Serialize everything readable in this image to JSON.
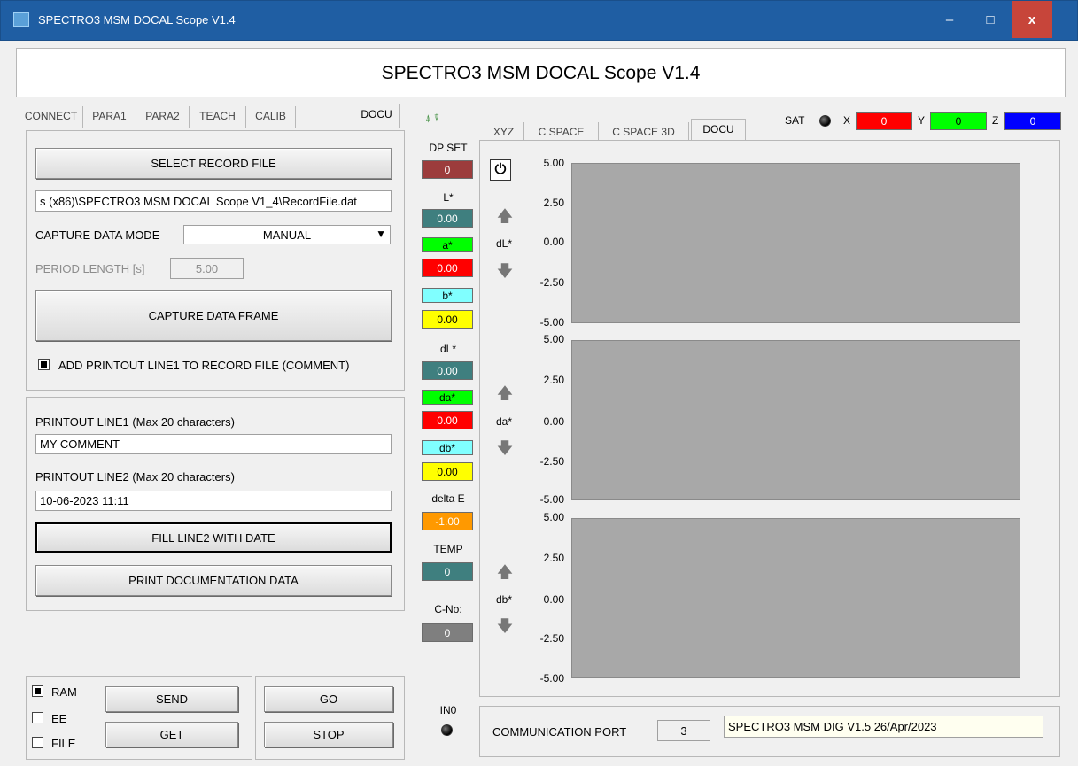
{
  "window": {
    "title": "SPECTRO3 MSM DOCAL Scope V1.4",
    "min_label": "‒",
    "max_label": "□",
    "close_label": "x"
  },
  "header": {
    "title": "SPECTRO3 MSM DOCAL Scope V1.4"
  },
  "left_tabs": [
    {
      "label": "CONNECT"
    },
    {
      "label": "PARA1"
    },
    {
      "label": "PARA2"
    },
    {
      "label": "TEACH"
    },
    {
      "label": "CALIB"
    },
    {
      "label": "DOCU"
    }
  ],
  "docu": {
    "select_record_file": "SELECT RECORD FILE",
    "record_file_path": "s (x86)\\SPECTRO3 MSM DOCAL Scope V1_4\\RecordFile.dat",
    "capture_mode_label": "CAPTURE DATA MODE",
    "capture_mode_value": "MANUAL",
    "period_label": "PERIOD LENGTH [s]",
    "period_value": "5.00",
    "capture_frame": "CAPTURE DATA FRAME",
    "add_printout_label": "ADD PRINTOUT LINE1 TO RECORD FILE (COMMENT)",
    "line1_label": "PRINTOUT LINE1 (Max 20 characters)",
    "line1_value": "MY COMMENT",
    "line2_label": "PRINTOUT LINE2 (Max 20 characters)",
    "line2_value": "10-06-2023  11:11",
    "fill_line2": "FILL LINE2 WITH DATE",
    "print_docu": "PRINT DOCUMENTATION DATA"
  },
  "bottom": {
    "ram": "RAM",
    "ee": "EE",
    "file": "FILE",
    "send": "SEND",
    "get": "GET",
    "go": "GO",
    "stop": "STOP"
  },
  "values": {
    "dp_set_label": "DP SET",
    "dp_set": "0",
    "L_label": "L*",
    "L": "0.00",
    "a_label": "a*",
    "a": "0.00",
    "b_label": "b*",
    "b": "0.00",
    "dL_label": "dL*",
    "dL": "0.00",
    "da_label": "da*",
    "da": "0.00",
    "db_label": "db*",
    "db": "0.00",
    "deltaE_label": "delta E",
    "deltaE": "-1.00",
    "temp_label": "TEMP",
    "temp": "0",
    "cno_label": "C-No:",
    "cno": "0",
    "in0_label": "IN0"
  },
  "right_tabs": [
    {
      "label": "XYZ"
    },
    {
      "label": "C SPACE"
    },
    {
      "label": "C SPACE 3D"
    },
    {
      "label": "DOCU"
    }
  ],
  "sat": {
    "label": "SAT",
    "x_label": "X",
    "x": "0",
    "y_label": "Y",
    "y": "0",
    "z_label": "Z",
    "z": "0"
  },
  "plots": [
    {
      "label": "dL*",
      "ticks": [
        "5.00",
        "2.50",
        "0.00",
        "-2.50",
        "-5.00"
      ]
    },
    {
      "label": "da*",
      "ticks": [
        "5.00",
        "2.50",
        "0.00",
        "-2.50",
        "-5.00"
      ]
    },
    {
      "label": "db*",
      "ticks": [
        "5.00",
        "2.50",
        "0.00",
        "-2.50",
        "-5.00"
      ]
    }
  ],
  "comm": {
    "label": "COMMUNICATION PORT",
    "port": "3",
    "device": "SPECTRO3 MSM DIG V1.5    26/Apr/2023"
  },
  "colors": {
    "title_bar": "#1f5ea3",
    "close": "#c7453a",
    "red": "#ff0000",
    "green": "#00ff00",
    "blue": "#0000ff",
    "yellow": "#ffff00",
    "cyan": "#80ffff",
    "teal": "#3f7f7f",
    "maroon": "#9c3c3c",
    "orange": "#ff9900",
    "plot": "#a8a8a8"
  },
  "icons": {
    "power": "power-icon",
    "arrow_up": "arrow-up-icon",
    "arrow_down": "arrow-down-icon"
  }
}
